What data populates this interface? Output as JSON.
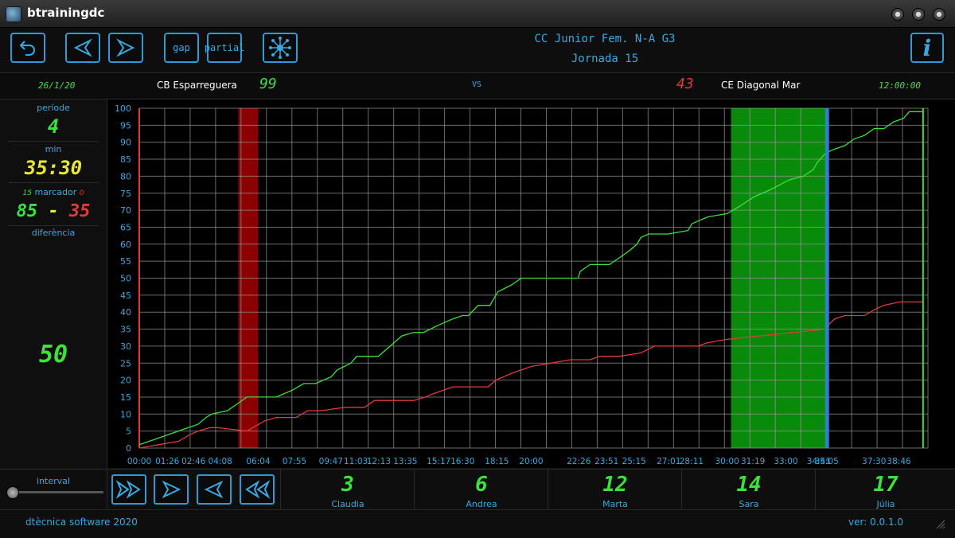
{
  "window": {
    "title": "btrainingdc"
  },
  "toolbar": {
    "gap_label": "gap",
    "partial_label": "partial",
    "match_title": "CC Junior Fem. N-A G3",
    "match_subtitle": "Jornada 15",
    "info_label": "i"
  },
  "scoreboard": {
    "date": "26/1/20",
    "home_team": "CB Esparreguera",
    "home_score": "99",
    "vs": "VS",
    "away_score": "43",
    "away_team": "CE Diagonal Mar",
    "time": "12:00:00"
  },
  "left_panel": {
    "period_label": "període",
    "period_value": "4",
    "min_label": "min",
    "min_value": "35:30",
    "marker_label": "marcador",
    "marker_home_small": "15",
    "marker_away_small": "0",
    "marker_home": "85",
    "marker_sep": "-",
    "marker_away": "35",
    "diff_label": "diferència",
    "diff_value": "50",
    "interval_label": "interval"
  },
  "colors": {
    "accent": "#3aa8e0",
    "home_line": "#3de03d",
    "away_line": "#e03a3a",
    "min_digits": "#e8e83a"
  },
  "chart_data": {
    "type": "line",
    "ylim": [
      0,
      100
    ],
    "yticks": [
      0,
      5,
      10,
      15,
      20,
      25,
      30,
      35,
      40,
      45,
      50,
      55,
      60,
      65,
      70,
      75,
      80,
      85,
      90,
      95,
      100
    ],
    "xlim": [
      0,
      40.25
    ],
    "xtick_labels": [
      "00:00",
      "01:26",
      "02:46",
      "04:08",
      "06:04",
      "07:55",
      "09:47",
      "11:03",
      "12:13",
      "13:35",
      "15:17",
      "16:30",
      "18:15",
      "20:00",
      "22:26",
      "23:51",
      "25:15",
      "27:01",
      "28:11",
      "30:00",
      "31:19",
      "33:00",
      "34:41",
      "35:05",
      "37:30",
      "38:46"
    ],
    "xtick_values": [
      0,
      1.43,
      2.77,
      4.13,
      6.07,
      7.92,
      9.78,
      11.05,
      12.22,
      13.58,
      15.28,
      16.5,
      18.25,
      20.0,
      22.43,
      23.85,
      25.25,
      27.02,
      28.18,
      30.0,
      31.32,
      33.0,
      34.68,
      35.08,
      37.5,
      38.77
    ],
    "series": [
      {
        "values_x": [
          0,
          1,
          2,
          3,
          3.4,
          3.7,
          4.5,
          5,
          5.5,
          6.1,
          7,
          7.8,
          8.4,
          9,
          9.8,
          10.1,
          10.8,
          11.1,
          11.5,
          12.2,
          12.6,
          13,
          13.4,
          14,
          14.5,
          15.2,
          16,
          16.5,
          16.8,
          17.3,
          17.9,
          18.1,
          18.3,
          19,
          19.5,
          20,
          21,
          22.4,
          22.5,
          23,
          24,
          24.5,
          25,
          25.4,
          25.6,
          26,
          27,
          28,
          28.2,
          29,
          30,
          30.6,
          31.4,
          32.2,
          33.2,
          33.9,
          34.4,
          34.6,
          34.9,
          35.1,
          35.5,
          36,
          36.5,
          37,
          37.5,
          38,
          38.5,
          39,
          39.3,
          39.7,
          40
        ],
        "values_y": [
          1,
          3,
          5,
          7,
          9,
          10,
          11,
          13,
          15,
          15,
          15,
          17,
          19,
          19,
          21,
          23,
          25,
          27,
          27,
          27,
          29,
          31,
          33,
          34,
          34,
          36,
          38,
          39,
          39,
          42,
          42,
          44,
          46,
          48,
          50,
          50,
          50,
          50,
          52,
          54,
          54,
          56,
          58,
          60,
          62,
          63,
          63,
          64,
          66,
          68,
          69,
          71,
          74,
          76,
          79,
          80,
          82,
          84,
          86,
          87,
          88,
          89,
          91,
          92,
          94,
          94,
          96,
          97,
          99,
          99,
          99
        ]
      },
      {
        "values_x": [
          0,
          1,
          2,
          2.6,
          3,
          3.6,
          4,
          5.5,
          6.4,
          7,
          8,
          8.6,
          9.3,
          10.5,
          11.5,
          12,
          12.8,
          14,
          14.6,
          15,
          16,
          17,
          17.8,
          18.2,
          19,
          20,
          21,
          22,
          22.4,
          23,
          23.5,
          24.5,
          25.6,
          26.3,
          27.4,
          28.5,
          29,
          30,
          35,
          35.3,
          35.5,
          36,
          37,
          37.6,
          38,
          38.8,
          40
        ],
        "values_y": [
          0,
          1,
          2,
          4,
          5,
          6,
          6,
          5,
          8,
          9,
          9,
          11,
          11,
          12,
          12,
          14,
          14,
          14,
          15,
          16,
          18,
          18,
          18,
          20,
          22,
          24,
          25,
          26,
          26,
          26,
          27,
          27,
          28,
          30,
          30,
          30,
          31,
          32,
          35,
          37,
          38,
          39,
          39,
          41,
          42,
          43,
          43
        ]
      }
    ],
    "highlight_regions": [
      {
        "x_start": 5.05,
        "x_end": 6.07,
        "color": "#8b0000"
      },
      {
        "x_start": 30.2,
        "x_end": 35.05,
        "color": "#0a8a0a"
      }
    ],
    "vertical_markers": [
      {
        "x": 35.1,
        "color": "#2f7fd6"
      },
      {
        "x": 40.0,
        "color": "#3de03d"
      }
    ],
    "grid": true
  },
  "players": [
    {
      "number": "3",
      "name": "Claudia"
    },
    {
      "number": "6",
      "name": "Andrea"
    },
    {
      "number": "12",
      "name": "Marta"
    },
    {
      "number": "14",
      "name": "Sara"
    },
    {
      "number": "17",
      "name": "Júlia"
    }
  ],
  "status": {
    "left": "dtècnica software 2020",
    "right": "ver: 0.0.1.0"
  }
}
